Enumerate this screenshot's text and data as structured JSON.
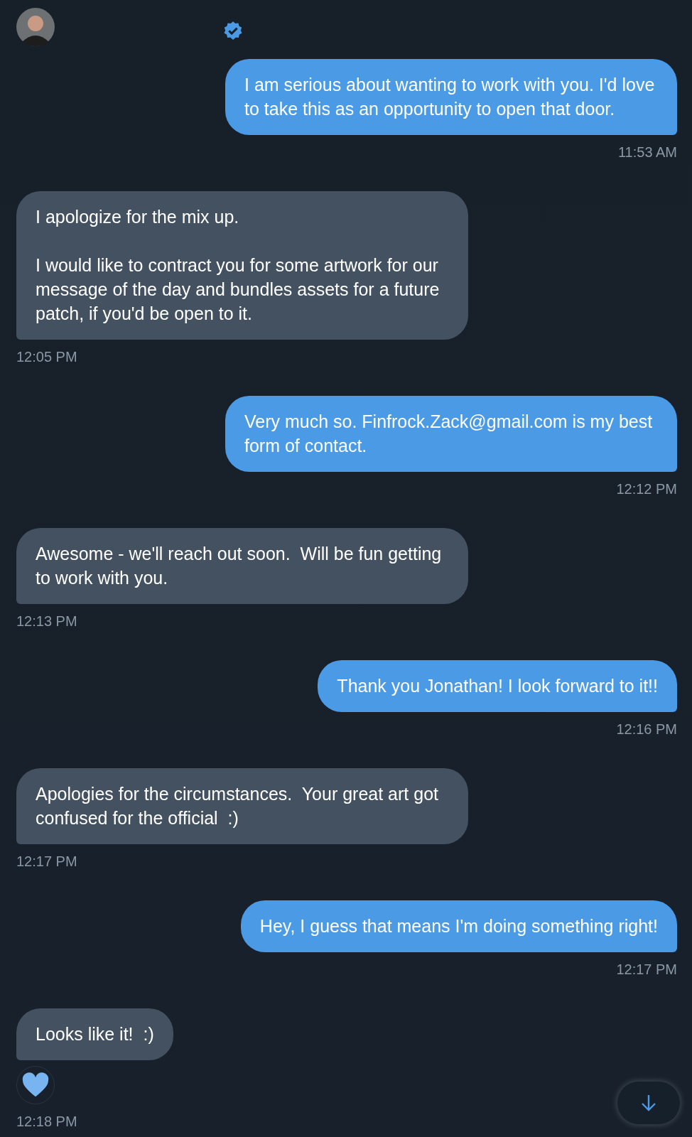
{
  "header": {
    "verified": true
  },
  "messages": [
    {
      "kind": "sent",
      "text": "I am serious about wanting to work with you. I'd love to take this as an opportunity to open that door.",
      "time": "11:53 AM",
      "liked": false
    },
    {
      "kind": "received",
      "text": "I apologize for the mix up.\n\nI would like to contract you for some artwork for our message of the day and bundles assets for a future patch, if you'd be open to it.",
      "time": "12:05 PM",
      "liked": false
    },
    {
      "kind": "sent",
      "text": "Very much so. Finfrock.Zack@gmail.com is my best form of contact.",
      "time": "12:12 PM",
      "liked": false
    },
    {
      "kind": "received",
      "text": "Awesome - we'll reach out soon.  Will be fun getting to work with you.",
      "time": "12:13 PM",
      "liked": false
    },
    {
      "kind": "sent",
      "text": "Thank you Jonathan! I look forward to it!!",
      "time": "12:16 PM",
      "liked": false
    },
    {
      "kind": "received",
      "text": "Apologies for the circumstances.  Your great art got confused for the official  :)",
      "time": "12:17 PM",
      "liked": false
    },
    {
      "kind": "sent",
      "text": "Hey, I guess that means I'm doing something right!",
      "time": "12:17 PM",
      "liked": false
    },
    {
      "kind": "received",
      "text": "Looks like it!  :)",
      "time": "12:18 PM",
      "liked": true
    }
  ]
}
